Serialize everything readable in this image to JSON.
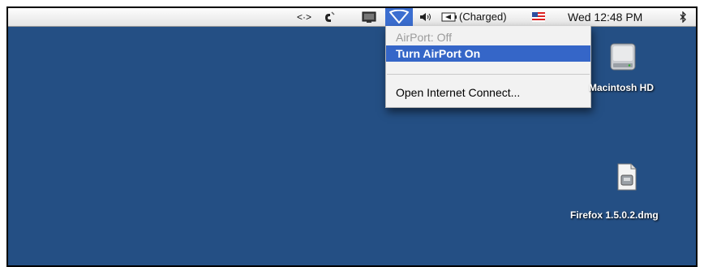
{
  "menubar": {
    "sync_icon": "<·>",
    "clock": "Wed 12:48 PM",
    "battery_status": "(Charged)",
    "bluetooth_icon": "bluetooth-icon",
    "flag_icon": "us-flag-icon"
  },
  "airport_menu": {
    "status": "AirPort: Off",
    "turn_on": "Turn AirPort On",
    "open_internet_connect": "Open Internet Connect..."
  },
  "desktop": {
    "icons": [
      {
        "label": "Macintosh HD",
        "icon": "hard-drive-icon"
      },
      {
        "label": "Firefox 1.5.0.2.dmg",
        "icon": "disk-image-icon"
      }
    ]
  },
  "colors": {
    "desktop": "#244f84",
    "highlight": "#3566c8"
  }
}
